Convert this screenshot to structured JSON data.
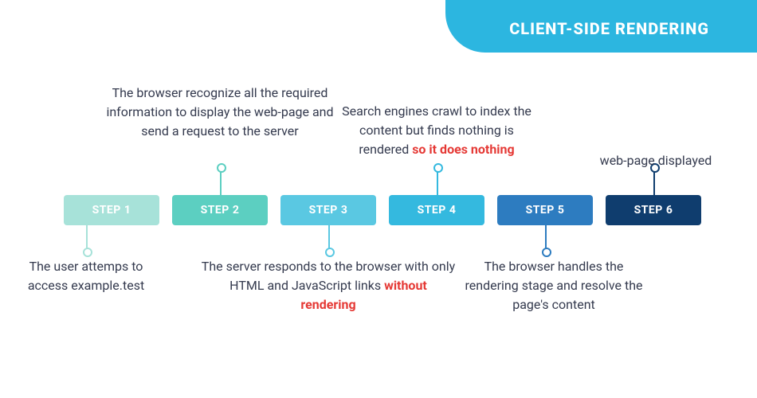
{
  "title": "CLIENT-SIDE RENDERING",
  "colors": {
    "banner": "#2cb6e0",
    "highlight": "#e53935",
    "steps": [
      "#a7e2d9",
      "#5ccfc1",
      "#5ac8e2",
      "#34b9df",
      "#2d7cc0",
      "#0f3d6e"
    ],
    "connectors": [
      "#a7e2d9",
      "#5ccfc1",
      "#5ac8e2",
      "#34b9df",
      "#2d7cc0",
      "#0f3d6e"
    ]
  },
  "steps": [
    {
      "label": "STEP 1"
    },
    {
      "label": "STEP 2"
    },
    {
      "label": "STEP 3"
    },
    {
      "label": "STEP 4"
    },
    {
      "label": "STEP 5"
    },
    {
      "label": "STEP 6"
    }
  ],
  "descriptions": {
    "d1": "The user attemps to access example.test",
    "d2": "The browser recognize all the required information to display the web-page and send a request to the server",
    "d3a": "The server responds to the browser with only HTML and JavaScript links ",
    "d3b": "without rendering",
    "d4a": "Search engines crawl to index the content but finds nothing is rendered ",
    "d4b": "so it does nothing",
    "d5": "The browser handles the rendering stage and resolve the page's content",
    "d6": "web-page displayed"
  }
}
